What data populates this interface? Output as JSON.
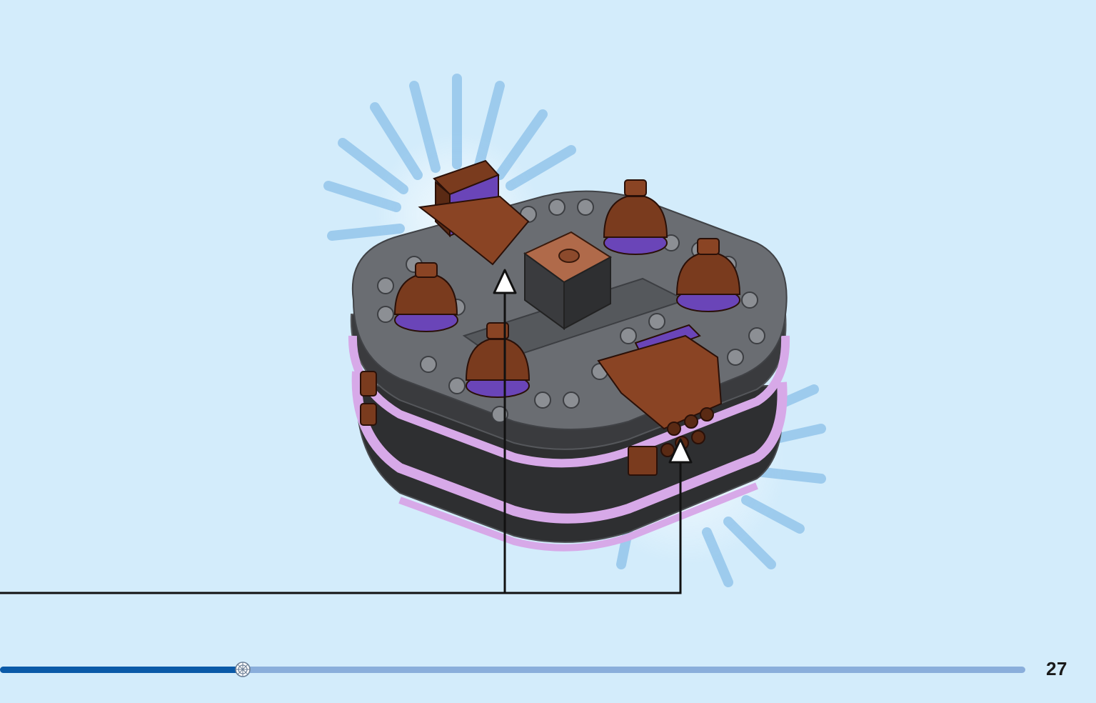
{
  "page": {
    "number": "27",
    "background_color": "#d3ecfb"
  },
  "progress": {
    "fraction": 0.237,
    "fill_color": "#0a5aa8",
    "track_color": "#8aaedb",
    "knob_icon": "gear-icon"
  },
  "illustration": {
    "subject_icon": "lego-brick-model-icon",
    "colors": {
      "dark_gray": "#5a5d61",
      "black": "#2e2f31",
      "brown": "#7a3b1e",
      "lavender": "#d7a9e8",
      "purple": "#6a45b8",
      "burst": "#7fb9e6"
    }
  }
}
